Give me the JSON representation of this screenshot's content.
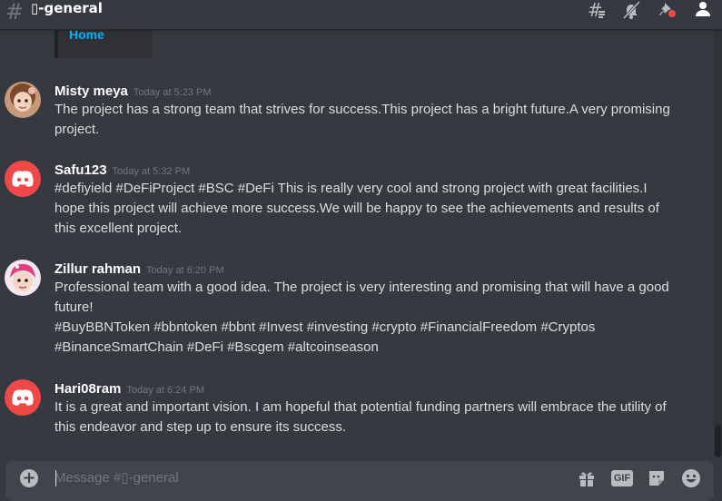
{
  "header": {
    "hash_glyph": "#",
    "channel_name": "▯-general",
    "icons": [
      "threads-icon",
      "mute-icon",
      "pin-icon",
      "members-icon"
    ]
  },
  "embed": {
    "link_text": "Home"
  },
  "messages": [
    {
      "username": "Misty meya",
      "timestamp": "Today at 5:23 PM",
      "body": "The project has a strong team that strives for success.This project has a bright future.A very promising project.",
      "avatar": "photo-avatar-doll"
    },
    {
      "username": "Safu123",
      "timestamp": "Today at 5:32 PM",
      "body": "#defiyield #DeFiProject #BSC #DeFi This is really very cool and strong project with great facilities.I hope this project will achieve more success.We will be happy to see the achievements and results of this excellent project.",
      "avatar": "discord-default-avatar"
    },
    {
      "username": "Zillur rahman",
      "timestamp": "Today at 6:20 PM",
      "body": "Professional team with a good idea. The project is very interesting and promising that will have a good future!",
      "body2": "#BuyBBNToken #bbntoken #bbnt #Invest #investing #crypto #FinancialFreedom #Cryptos #BinanceSmartChain #DeFi #Bscgem #altcoinseason",
      "avatar": "photo-avatar-child"
    },
    {
      "username": "Hari08ram",
      "timestamp": "Today at 6:24 PM",
      "body": "It is a great and important vision. I am hopeful that potential funding partners will embrace the utility of this endeavor and step up to ensure its success.",
      "avatar": "discord-default-avatar"
    }
  ],
  "composer": {
    "placeholder": "Message #▯-general",
    "gif_label": "GIF"
  },
  "colors": {
    "background": "#36393f",
    "discord_red": "#f04747",
    "link_blue": "#00b0f4",
    "username": "#ffffff",
    "timestamp": "#72767d",
    "text": "#dcddde"
  }
}
